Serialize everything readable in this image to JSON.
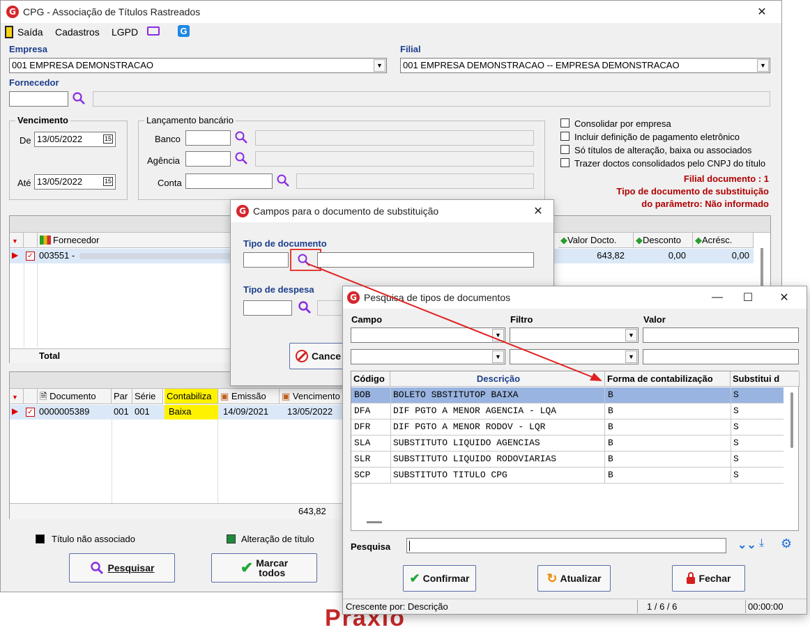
{
  "main": {
    "title": "CPG - Associação de Títulos Rastreados",
    "menu": [
      "Saída",
      "Cadastros",
      "LGPD"
    ],
    "empresa_label": "Empresa",
    "empresa_value": "001 EMPRESA DEMONSTRACAO",
    "filial_label": "Filial",
    "filial_value": "001 EMPRESA DEMONSTRACAO -- EMPRESA DEMONSTRACAO",
    "fornecedor_label": "Fornecedor",
    "vencimento_label": "Vencimento",
    "de_label": "De",
    "de_value": "13/05/2022",
    "ate_label": "Até",
    "ate_value": "13/05/2022",
    "lancamento_label": "Lançamento bancário",
    "banco_label": "Banco",
    "agencia_label": "Agência",
    "conta_label": "Conta",
    "checks": [
      "Consolidar por empresa",
      "Incluir definição de pagamento eletrônico",
      "Só títulos de alteração, baixa ou associados",
      "Trazer doctos consolidados pelo CNPJ do título"
    ],
    "filial_documento": "Filial documento : 1",
    "tipo_doc_subst_1": "Tipo de documento de substituição",
    "tipo_doc_subst_2": "do parâmetro: Não informado",
    "grid1": {
      "col_fornecedor": "Fornecedor",
      "col_valor": "Valor Docto.",
      "col_desconto": "Desconto",
      "col_acresc": "Acrésc.",
      "row_fornecedor": "003551 -",
      "row_valor": "643,82",
      "row_desconto": "0,00",
      "row_acresc": "0,00",
      "total_label": "Total"
    },
    "grid2": {
      "col_documento": "Documento",
      "col_par": "Par",
      "col_serie": "Série",
      "col_contabiliza": "Contabiliza",
      "col_emissao": "Emissão",
      "col_vencimento": "Vencimento",
      "row_documento": "0000005389",
      "row_par": "001",
      "row_serie": "001",
      "row_contabiliza": "Baixa",
      "row_emissao": "14/09/2021",
      "row_vencimento": "13/05/2022",
      "total_value": "643,82"
    },
    "legend_nao_associado": "Título não associado",
    "legend_alteracao": "Alteração de título",
    "btn_pesquisar": "Pesquisar",
    "btn_marcar_1": "Marcar",
    "btn_marcar_2": "todos",
    "colors": {
      "highlight": "#fff200",
      "legend_green": "#1f8a3a",
      "legend_black": "#000000"
    }
  },
  "dialog_campos": {
    "title": "Campos para o documento de substituição",
    "tipo_documento_label": "Tipo de documento",
    "tipo_despesa_label": "Tipo de  despesa",
    "cancel_label": "Cance"
  },
  "dialog_pesquisa": {
    "title": "Pesquisa de tipos de documentos",
    "campo_label": "Campo",
    "filtro_label": "Filtro",
    "valor_label": "Valor",
    "headers": [
      "Código",
      "Descrição",
      "Forma de contabilização",
      "Substitui d"
    ],
    "rows": [
      [
        "BOB",
        "BOLETO SBSTITUTOP BAIXA",
        "B",
        "S"
      ],
      [
        "DFA",
        "DIF PGTO A MENOR AGENCIA - LQA",
        "B",
        "S"
      ],
      [
        "DFR",
        "DIF PGTO A MENOR RODOV - LQR",
        "B",
        "S"
      ],
      [
        "SLA",
        "SUBSTITUTO LIQUIDO AGENCIAS",
        "B",
        "S"
      ],
      [
        "SLR",
        "SUBSTITUTO LIQUIDO RODOVIARIAS",
        "B",
        "S"
      ],
      [
        "SCP",
        "SUBSTITUTO TITULO CPG",
        "B",
        "S"
      ]
    ],
    "pesquisa_label": "Pesquisa",
    "btn_confirmar": "Confirmar",
    "btn_atualizar": "Atualizar",
    "btn_fechar": "Fechar",
    "status_left": "Crescente por: Descrição",
    "status_count": "1 / 6 / 6",
    "status_time": "00:00:00",
    "colors": {
      "selected_row": "#99b4e0",
      "header_blue": "#1b3e8c"
    }
  },
  "background_text": "Praxio"
}
